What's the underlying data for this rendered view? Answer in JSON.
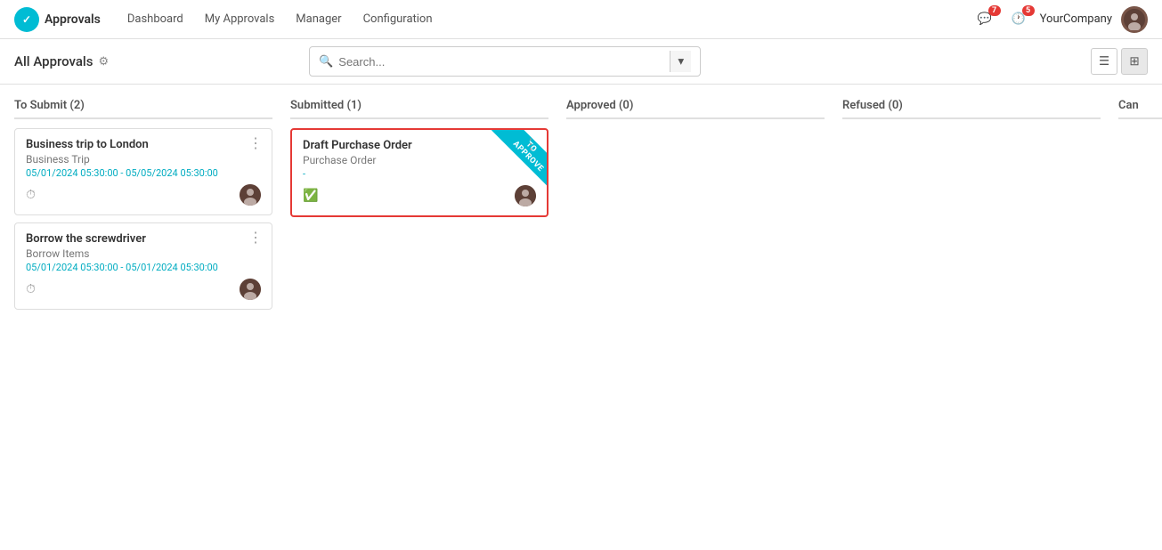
{
  "topnav": {
    "brand_icon": "A",
    "brand_name": "Approvals",
    "links": [
      "Dashboard",
      "My Approvals",
      "Manager",
      "Configuration"
    ],
    "notif1_count": "7",
    "notif2_count": "5",
    "company": "YourCompany"
  },
  "subheader": {
    "title": "All Approvals",
    "search_placeholder": "Search...",
    "gear_icon": "⚙"
  },
  "columns": [
    {
      "label": "To Submit (2)",
      "cards": [
        {
          "title": "Business trip to London",
          "subtitle": "Business Trip",
          "date": "05/01/2024 05:30:00 - 05/05/2024 05:30:00",
          "has_clock": true,
          "selected": false,
          "ribbon": null
        },
        {
          "title": "Borrow the screwdriver",
          "subtitle": "Borrow Items",
          "date": "05/01/2024 05:30:00 - 05/01/2024 05:30:00",
          "has_clock": true,
          "selected": false,
          "ribbon": null
        }
      ]
    },
    {
      "label": "Submitted (1)",
      "cards": [
        {
          "title": "Draft Purchase Order",
          "subtitle": "Purchase Order",
          "date": "-",
          "has_clock": false,
          "has_check": true,
          "selected": true,
          "ribbon": "TO APPROVE"
        }
      ]
    },
    {
      "label": "Approved (0)",
      "cards": []
    },
    {
      "label": "Refused (0)",
      "cards": []
    },
    {
      "label": "Can",
      "cards": []
    }
  ],
  "view_list_icon": "☰",
  "view_kanban_icon": "⊞"
}
